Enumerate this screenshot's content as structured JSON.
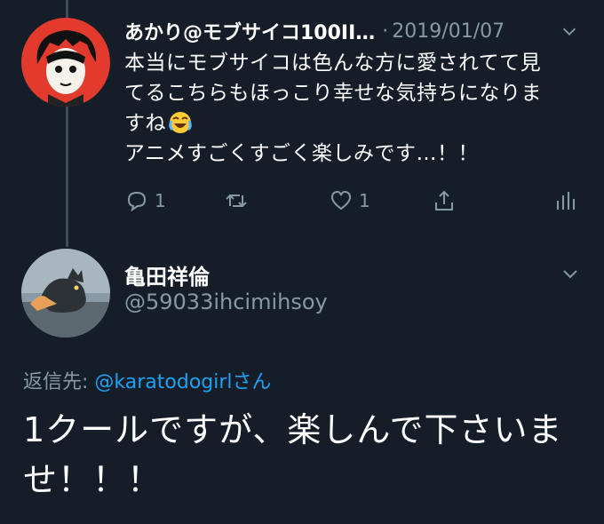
{
  "tweet": {
    "author_name": "あかり@モブサイコ100II…",
    "dot": "·",
    "date": "2019/01/07",
    "text_line1": "本当にモブサイコは色んな方に愛されてて見",
    "text_line2": "てるこちらもほっこり幸せな気持ちになりま",
    "text_line3": "すね",
    "text_line4": "アニメすごくすごく楽しみです…！！",
    "emoji": "joy-emoji",
    "reply_count": "1",
    "like_count": "1"
  },
  "reply": {
    "author_name": "亀田祥倫",
    "handle": "@59033ihcimihsoy",
    "reply_to_prefix": "返信先: ",
    "reply_to_mention": "@karatodogirl",
    "reply_to_suffix": "さん",
    "text_line1": "1クールですが、楽しんで下さいま",
    "text_line2": "せ！！！"
  },
  "colors": {
    "background": "#151d28",
    "muted": "#8899a6",
    "link": "#1da1f2"
  }
}
